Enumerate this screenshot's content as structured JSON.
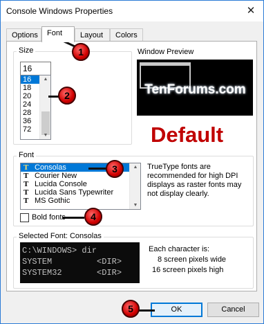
{
  "window": {
    "title": "Console Windows Properties",
    "close_glyph": "✕"
  },
  "tabs": [
    {
      "label": "Options"
    },
    {
      "label": "Font"
    },
    {
      "label": "Layout"
    },
    {
      "label": "Colors"
    }
  ],
  "size_group": {
    "label": "Size",
    "input_value": "16",
    "items": [
      "16",
      "18",
      "20",
      "24",
      "28",
      "36",
      "72"
    ],
    "selected": "16"
  },
  "preview": {
    "label": "Window Preview"
  },
  "watermark": "TenForums.com",
  "default_label": "Default",
  "font_group": {
    "label": "Font",
    "items": [
      {
        "name": "Consolas",
        "selected": true
      },
      {
        "name": "Courier New",
        "selected": false
      },
      {
        "name": "Lucida Console",
        "selected": false
      },
      {
        "name": "Lucida Sans Typewriter",
        "selected": false
      },
      {
        "name": "MS Gothic",
        "selected": false
      }
    ],
    "tt_glyph": "T",
    "note": "TrueType fonts are recommended for high DPI displays as raster fonts may not display clearly."
  },
  "bold_fonts": {
    "label": "Bold fonts",
    "checked": false
  },
  "selected_font": {
    "label": "Selected Font: Consolas",
    "console_lines": [
      "C:\\WINDOWS> dir",
      "SYSTEM         <DIR>",
      "SYSTEM32       <DIR>"
    ],
    "char_info_title": "Each character is:",
    "char_width": "8 screen pixels wide",
    "char_height": "16 screen pixels high"
  },
  "buttons": {
    "ok": "OK",
    "cancel": "Cancel"
  },
  "callouts": [
    "1",
    "2",
    "3",
    "4",
    "5"
  ],
  "colors": {
    "accent": "#0078d7",
    "callout": "#d00000",
    "default_label": "#c00000"
  }
}
